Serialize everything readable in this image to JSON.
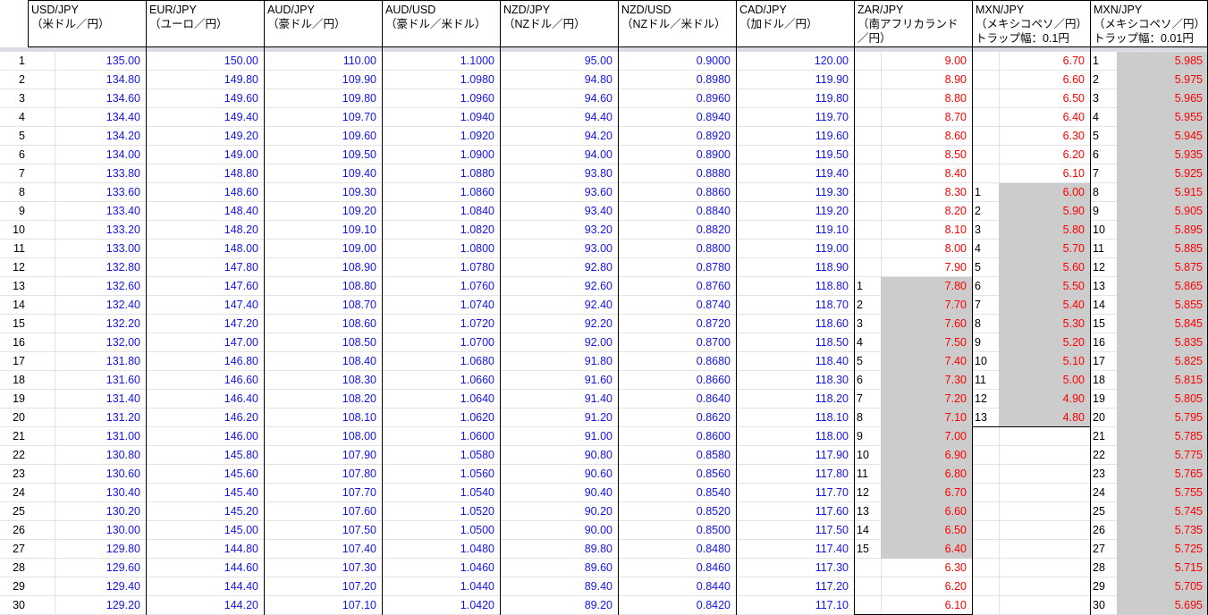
{
  "sheet": {
    "headers": [
      {
        "line1": "USD/JPY",
        "line2": "（米ドル／円）",
        "line3": ""
      },
      {
        "line1": "EUR/JPY",
        "line2": "（ユーロ／円）",
        "line3": ""
      },
      {
        "line1": "AUD/JPY",
        "line2": "（豪ドル／円）",
        "line3": ""
      },
      {
        "line1": "AUD/USD",
        "line2": "（豪ドル／米ドル）",
        "line3": ""
      },
      {
        "line1": "NZD/JPY",
        "line2": "（NZドル／円）",
        "line3": ""
      },
      {
        "line1": "NZD/USD",
        "line2": "（NZドル／米ドル）",
        "line3": ""
      },
      {
        "line1": "CAD/JPY",
        "line2": "（加ドル／円）",
        "line3": ""
      },
      {
        "line1": "ZAR/JPY",
        "line2": "（南アフリカランド",
        "line3": "／円）"
      },
      {
        "line1": "MXN/JPY",
        "line2": "（メキシコペソ／円）",
        "line3": "トラップ幅：0.1円"
      },
      {
        "line1": "MXN/JPY",
        "line2": "（メキシコペソ／円）",
        "line3": "トラップ幅：0.01円"
      }
    ],
    "row_numbers": [
      "1",
      "2",
      "3",
      "4",
      "5",
      "6",
      "7",
      "8",
      "9",
      "10",
      "11",
      "12",
      "13",
      "14",
      "15",
      "16",
      "17",
      "18",
      "19",
      "20",
      "21",
      "22",
      "23",
      "24",
      "25",
      "26",
      "27",
      "28",
      "29",
      "30"
    ],
    "usd_jpy": [
      "135.00",
      "134.80",
      "134.60",
      "134.40",
      "134.20",
      "134.00",
      "133.80",
      "133.60",
      "133.40",
      "133.20",
      "133.00",
      "132.80",
      "132.60",
      "132.40",
      "132.20",
      "132.00",
      "131.80",
      "131.60",
      "131.40",
      "131.20",
      "131.00",
      "130.80",
      "130.60",
      "130.40",
      "130.20",
      "130.00",
      "129.80",
      "129.60",
      "129.40",
      "129.20"
    ],
    "eur_jpy": [
      "150.00",
      "149.80",
      "149.60",
      "149.40",
      "149.20",
      "149.00",
      "148.80",
      "148.60",
      "148.40",
      "148.20",
      "148.00",
      "147.80",
      "147.60",
      "147.40",
      "147.20",
      "147.00",
      "146.80",
      "146.60",
      "146.40",
      "146.20",
      "146.00",
      "145.80",
      "145.60",
      "145.40",
      "145.20",
      "145.00",
      "144.80",
      "144.60",
      "144.40",
      "144.20"
    ],
    "aud_jpy": [
      "110.00",
      "109.90",
      "109.80",
      "109.70",
      "109.60",
      "109.50",
      "109.40",
      "109.30",
      "109.20",
      "109.10",
      "109.00",
      "108.90",
      "108.80",
      "108.70",
      "108.60",
      "108.50",
      "108.40",
      "108.30",
      "108.20",
      "108.10",
      "108.00",
      "107.90",
      "107.80",
      "107.70",
      "107.60",
      "107.50",
      "107.40",
      "107.30",
      "107.20",
      "107.10"
    ],
    "aud_usd": [
      "1.1000",
      "1.0980",
      "1.0960",
      "1.0940",
      "1.0920",
      "1.0900",
      "1.0880",
      "1.0860",
      "1.0840",
      "1.0820",
      "1.0800",
      "1.0780",
      "1.0760",
      "1.0740",
      "1.0720",
      "1.0700",
      "1.0680",
      "1.0660",
      "1.0640",
      "1.0620",
      "1.0600",
      "1.0580",
      "1.0560",
      "1.0540",
      "1.0520",
      "1.0500",
      "1.0480",
      "1.0460",
      "1.0440",
      "1.0420"
    ],
    "nzd_jpy": [
      "95.00",
      "94.80",
      "94.60",
      "94.40",
      "94.20",
      "94.00",
      "93.80",
      "93.60",
      "93.40",
      "93.20",
      "93.00",
      "92.80",
      "92.60",
      "92.40",
      "92.20",
      "92.00",
      "91.80",
      "91.60",
      "91.40",
      "91.20",
      "91.00",
      "90.80",
      "90.60",
      "90.40",
      "90.20",
      "90.00",
      "89.80",
      "89.60",
      "89.40",
      "89.20"
    ],
    "nzd_usd": [
      "0.9000",
      "0.8980",
      "0.8960",
      "0.8940",
      "0.8920",
      "0.8900",
      "0.8880",
      "0.8860",
      "0.8840",
      "0.8820",
      "0.8800",
      "0.8780",
      "0.8760",
      "0.8740",
      "0.8720",
      "0.8700",
      "0.8680",
      "0.8660",
      "0.8640",
      "0.8620",
      "0.8600",
      "0.8580",
      "0.8560",
      "0.8540",
      "0.8520",
      "0.8500",
      "0.8480",
      "0.8460",
      "0.8440",
      "0.8420"
    ],
    "cad_jpy": [
      "120.00",
      "119.90",
      "119.80",
      "119.70",
      "119.60",
      "119.50",
      "119.40",
      "119.30",
      "119.20",
      "119.10",
      "119.00",
      "118.90",
      "118.80",
      "118.70",
      "118.60",
      "118.50",
      "118.40",
      "118.30",
      "118.20",
      "118.10",
      "118.00",
      "117.90",
      "117.80",
      "117.70",
      "117.60",
      "117.50",
      "117.40",
      "117.30",
      "117.20",
      "117.10"
    ],
    "zar_jpy": [
      "9.00",
      "8.90",
      "8.80",
      "8.70",
      "8.60",
      "8.50",
      "8.40",
      "8.30",
      "8.20",
      "8.10",
      "8.00",
      "7.90",
      "7.80",
      "7.70",
      "7.60",
      "7.50",
      "7.40",
      "7.30",
      "7.20",
      "7.10",
      "7.00",
      "6.90",
      "6.80",
      "6.70",
      "6.60",
      "6.50",
      "6.40",
      "6.30",
      "6.20",
      "6.10"
    ],
    "zar_trap_index": [
      "",
      "",
      "",
      "",
      "",
      "",
      "",
      "",
      "",
      "",
      "",
      "",
      "1",
      "2",
      "3",
      "4",
      "5",
      "6",
      "7",
      "8",
      "9",
      "10",
      "11",
      "12",
      "13",
      "14",
      "15",
      "",
      "",
      ""
    ],
    "mxn_jpy_01": [
      "6.70",
      "6.60",
      "6.50",
      "6.40",
      "6.30",
      "6.20",
      "6.10",
      "6.00",
      "5.90",
      "5.80",
      "5.70",
      "5.60",
      "5.50",
      "5.40",
      "5.30",
      "5.20",
      "5.10",
      "5.00",
      "4.90",
      "4.80",
      "",
      "",
      "",
      "",
      "",
      "",
      "",
      "",
      "",
      ""
    ],
    "mxn01_trap_index": [
      "",
      "",
      "",
      "",
      "",
      "",
      "",
      "1",
      "2",
      "3",
      "4",
      "5",
      "6",
      "7",
      "8",
      "9",
      "10",
      "11",
      "12",
      "13",
      "",
      "",
      "",
      "",
      "",
      "",
      "",
      "",
      "",
      ""
    ],
    "mxn_jpy_001": [
      "5.985",
      "5.975",
      "5.965",
      "5.955",
      "5.945",
      "5.935",
      "5.925",
      "5.915",
      "5.905",
      "5.895",
      "5.885",
      "5.875",
      "5.865",
      "5.855",
      "5.845",
      "5.835",
      "5.825",
      "5.815",
      "5.805",
      "5.795",
      "5.785",
      "5.775",
      "5.765",
      "5.755",
      "5.745",
      "5.735",
      "5.725",
      "5.715",
      "5.705",
      "5.695"
    ],
    "mxn001_trap_index": [
      "1",
      "2",
      "3",
      "4",
      "5",
      "6",
      "7",
      "8",
      "9",
      "10",
      "11",
      "12",
      "13",
      "14",
      "15",
      "16",
      "17",
      "18",
      "19",
      "20",
      "21",
      "22",
      "23",
      "24",
      "25",
      "26",
      "27",
      "28",
      "29",
      "30"
    ]
  }
}
